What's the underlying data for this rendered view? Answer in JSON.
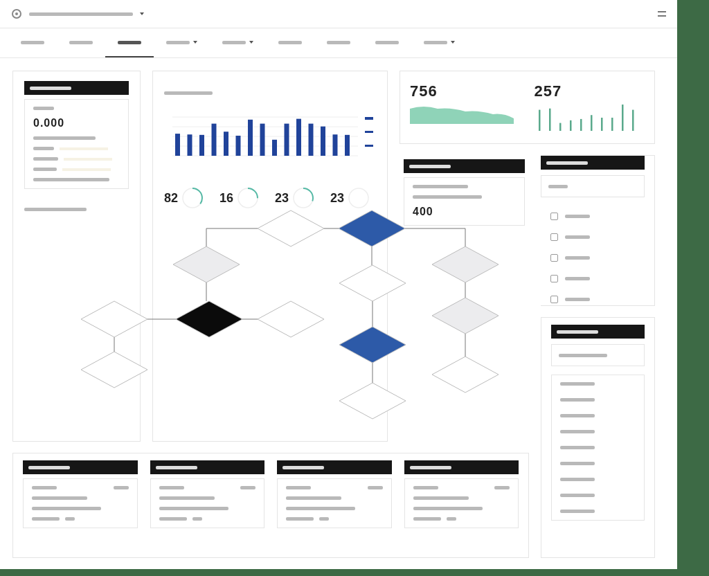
{
  "tabs": [
    {
      "selected": false,
      "dropdown": false
    },
    {
      "selected": false,
      "dropdown": false
    },
    {
      "selected": true,
      "dropdown": false
    },
    {
      "selected": false,
      "dropdown": true
    },
    {
      "selected": false,
      "dropdown": true
    },
    {
      "selected": false,
      "dropdown": false
    },
    {
      "selected": false,
      "dropdown": false
    },
    {
      "selected": false,
      "dropdown": false
    },
    {
      "selected": false,
      "dropdown": true
    }
  ],
  "left_panel": {
    "value": "0.000"
  },
  "gauges": [
    {
      "value": "82"
    },
    {
      "value": "16"
    },
    {
      "value": "23"
    },
    {
      "value": "23"
    }
  ],
  "stats": [
    {
      "value": "756",
      "kind": "area"
    },
    {
      "value": "257",
      "kind": "bars"
    }
  ],
  "detail_card": {
    "value": "400"
  },
  "option_list": [
    {
      "checked": false
    },
    {
      "checked": false
    },
    {
      "checked": false
    },
    {
      "checked": false
    },
    {
      "checked": false
    }
  ],
  "flowchart": {
    "nodes": [
      {
        "kind": "default"
      },
      {
        "kind": "primary"
      },
      {
        "kind": "muted"
      },
      {
        "kind": "default"
      },
      {
        "kind": "muted"
      },
      {
        "kind": "default"
      },
      {
        "kind": "dark"
      },
      {
        "kind": "default"
      },
      {
        "kind": "primary"
      },
      {
        "kind": "muted"
      },
      {
        "kind": "default"
      },
      {
        "kind": "default"
      },
      {
        "kind": "default"
      }
    ]
  },
  "bottom_cards": [
    {
      "kind": "summary"
    },
    {
      "kind": "summary"
    },
    {
      "kind": "summary"
    },
    {
      "kind": "summary"
    }
  ],
  "detail_list": [
    {
      "kind": "line"
    },
    {
      "kind": "line"
    },
    {
      "kind": "line"
    },
    {
      "kind": "line"
    },
    {
      "kind": "line"
    },
    {
      "kind": "line"
    },
    {
      "kind": "line"
    },
    {
      "kind": "line"
    },
    {
      "kind": "line"
    }
  ]
}
